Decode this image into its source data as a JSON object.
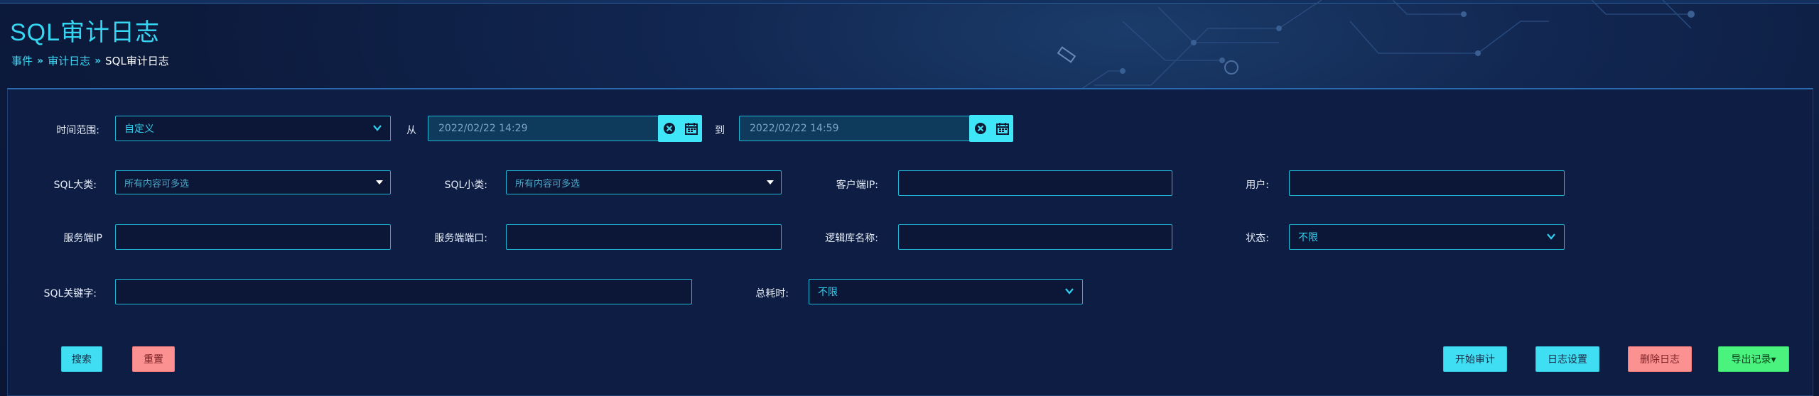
{
  "page": {
    "title": "SQL审计日志",
    "breadcrumb": [
      "事件",
      "审计日志",
      "SQL审计日志"
    ],
    "breadcrumb_sep": "»"
  },
  "form": {
    "time_range": {
      "label": "时间范围:",
      "value": "自定义"
    },
    "from_label": "从",
    "from_value": "2022/02/22 14:29",
    "to_label": "到",
    "to_value": "2022/02/22 14:59",
    "sql_major": {
      "label": "SQL大类:",
      "placeholder": "所有内容可多选"
    },
    "sql_minor": {
      "label": "SQL小类:",
      "placeholder": "所有内容可多选"
    },
    "client_ip": {
      "label": "客户端IP:",
      "value": ""
    },
    "user": {
      "label": "用户:",
      "value": ""
    },
    "server_ip": {
      "label": "服务端IP",
      "value": ""
    },
    "server_port": {
      "label": "服务端端口:",
      "value": ""
    },
    "logic_db": {
      "label": "逻辑库名称:",
      "value": ""
    },
    "status": {
      "label": "状态:",
      "value": "不限"
    },
    "sql_keyword": {
      "label": "SQL关键字:",
      "value": ""
    },
    "total_time": {
      "label": "总耗时:",
      "value": "不限"
    }
  },
  "buttons": {
    "search": "搜索",
    "reset": "重置",
    "start_audit": "开始审计",
    "log_settings": "日志设置",
    "delete_logs": "删除日志",
    "export": "导出记录▾"
  },
  "colors": {
    "accent": "#36d6f2",
    "cyan_button": "#40def2",
    "pink_button": "#fb9190",
    "green_button": "#4af27e",
    "background": "#0c1838"
  },
  "icons": [
    "clear-icon",
    "calendar-icon",
    "chevron-down-icon",
    "dropdown-triangle-icon"
  ]
}
